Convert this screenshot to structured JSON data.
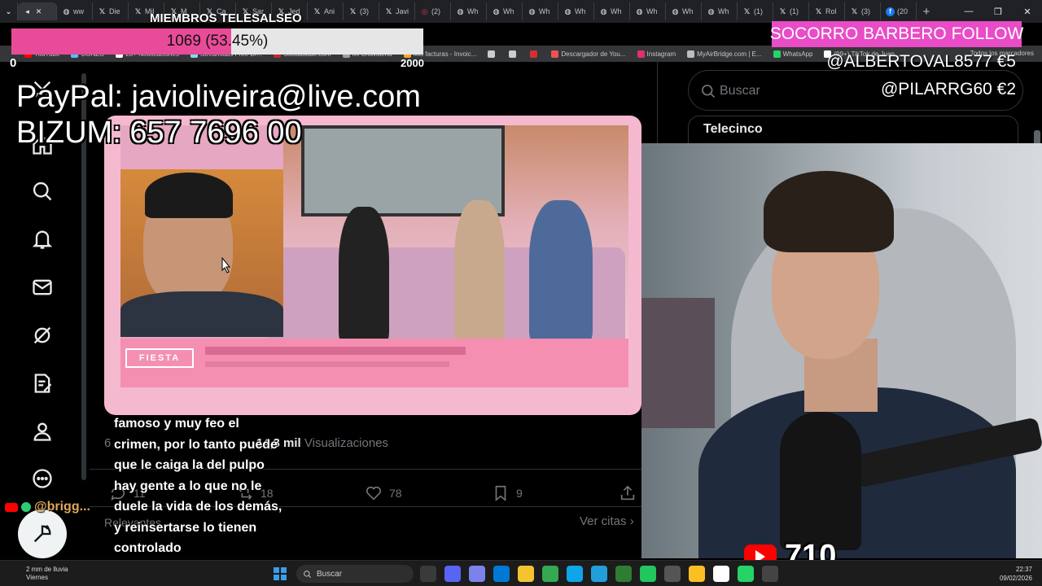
{
  "browser": {
    "tabs": [
      {
        "label": "ww",
        "icon": "globe"
      },
      {
        "label": "Die",
        "icon": "x"
      },
      {
        "label": "Mil",
        "icon": "x"
      },
      {
        "label": "M",
        "icon": "x"
      },
      {
        "label": "Ca",
        "icon": "x"
      },
      {
        "label": "Sar",
        "icon": "x"
      },
      {
        "label": "Jed",
        "icon": "x"
      },
      {
        "label": "Ani",
        "icon": "x"
      },
      {
        "label": "(3)",
        "icon": "x"
      },
      {
        "label": "Javi",
        "icon": "x"
      },
      {
        "label": "(2)",
        "icon": "instagram"
      },
      {
        "label": "Wh",
        "icon": "globe"
      },
      {
        "label": "Wh",
        "icon": "globe"
      },
      {
        "label": "Wh",
        "icon": "globe"
      },
      {
        "label": "Wh",
        "icon": "globe"
      },
      {
        "label": "Wh",
        "icon": "globe"
      },
      {
        "label": "Wh",
        "icon": "globe"
      },
      {
        "label": "Wh",
        "icon": "globe"
      },
      {
        "label": "Wh",
        "icon": "globe"
      },
      {
        "label": "(1)",
        "icon": "x"
      },
      {
        "label": "(1)",
        "icon": "x"
      },
      {
        "label": "Rol",
        "icon": "x"
      },
      {
        "label": "(3)",
        "icon": "x"
      },
      {
        "label": "(20",
        "icon": "facebook"
      }
    ],
    "new_tab": "+",
    "bookmarks": [
      {
        "label": "YouTube",
        "color": "#ff0000"
      },
      {
        "label": "CONZO",
        "color": "#4fc3f7"
      },
      {
        "label": "20+ Notificaciones",
        "color": "#ffffff"
      },
      {
        "label": "Streamlabs Free Dr...",
        "color": "#80deea"
      },
      {
        "label": "Socialblade.com",
        "color": "#c62828"
      },
      {
        "label": "Mi Chavalena",
        "color": "#9e9e9e"
      },
      {
        "label": "Mis facturas - Invoic...",
        "color": "#f9a825"
      },
      {
        "label": "",
        "color": "#cccccc"
      },
      {
        "label": "",
        "color": "#cccccc"
      },
      {
        "label": "",
        "color": "#d32f2f"
      },
      {
        "label": "Descargador de You...",
        "color": "#ef5350"
      },
      {
        "label": "Instagram",
        "color": "#e1306c"
      },
      {
        "label": "MyAirBridge.com | E...",
        "color": "#bdbdbd"
      },
      {
        "label": "WhatsApp",
        "color": "#25d366"
      },
      {
        "label": "(99+) TikTok de Juan...",
        "color": "#ffffff"
      }
    ],
    "bookmarks_all": "Todos los marcadores"
  },
  "x_sidebar": {
    "icons": [
      "home-icon",
      "search-icon",
      "notifications-icon",
      "messages-icon",
      "grok-icon",
      "lists-icon",
      "profile-icon",
      "more-icon"
    ],
    "post_button_icon": "compose-icon"
  },
  "post": {
    "metric_views_count": "14,3 mil",
    "metric_views_label": "Visualizaciones",
    "metric_prefix": "6",
    "replies": "11",
    "reposts": "18",
    "likes": "78",
    "bookmarks": "9",
    "relevant_label": "Relevantes",
    "quotes_link": "Ver citas"
  },
  "right_sidebar": {
    "search_placeholder": "Buscar",
    "trend_heading": "Telecinco"
  },
  "overlays": {
    "goal_title": "MIEMBROS TELESALSEO",
    "goal_current": 1069,
    "goal_percent_text": "1069 (53.45%)",
    "goal_fraction": 0.5345,
    "goal_min": "0",
    "goal_max": "2000",
    "paypal": "PayPal: javioliveira@live.com",
    "bizum": "BIZUM: 657 7696 00",
    "alert": "SOCORRO BARBERO  FOLLOW",
    "donation_1": "@ALBERTOVAL8577  €5",
    "donation_2": "@PILARRG60  €2",
    "chat_user": "@brigg...",
    "chat_message": "famoso y muy feo el crimen, por lo tanto puede que le caiga la del pulpo hay gente a lo que no le duele la vida de los demás, y reinsertarse lo tienen controlado",
    "video_lower_third_logo": "FIESTA",
    "youtube_viewers": "710"
  },
  "taskbar": {
    "weather_line1": "2 mm de lluvia",
    "weather_line2": "Viernes",
    "search_placeholder": "Buscar",
    "time": "22:37",
    "date": "09/02/2026",
    "app_colors": [
      "#3a3a3a",
      "#5865f2",
      "#7b83eb",
      "#0078d4",
      "#f4c430",
      "#34a853",
      "#0ea5e9",
      "#229ed9",
      "#2e7d32",
      "#22c55e",
      "#555555",
      "#fbbf24",
      "#ffffff",
      "#25d366",
      "#444444"
    ]
  }
}
